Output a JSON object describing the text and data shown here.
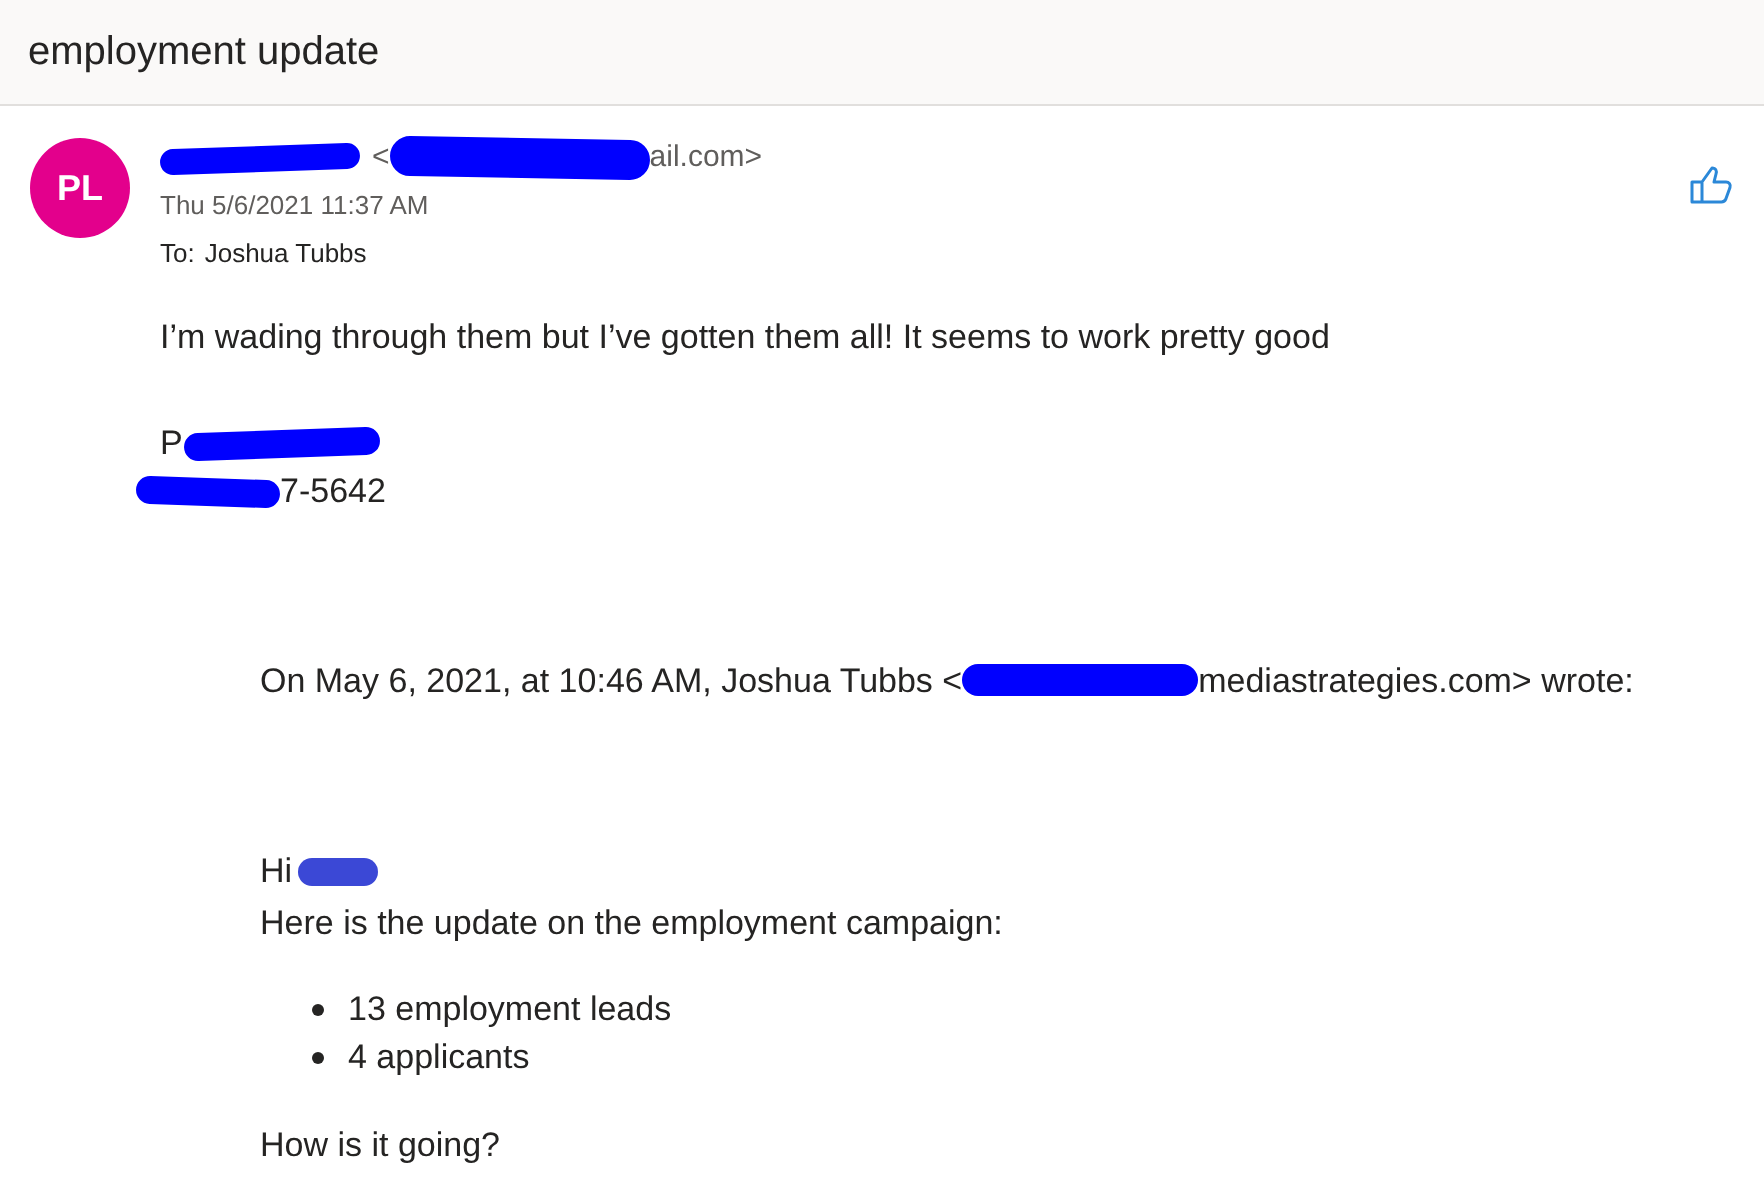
{
  "subject": "employment update",
  "sender": {
    "initials": "PL",
    "address_start": "<",
    "address_end": "ail.com>",
    "date": "Thu 5/6/2021 11:37 AM",
    "to_label": "To:",
    "to": "Joshua Tubbs"
  },
  "body": "I’m wading through them but I’ve gotten them all! It seems to work pretty good",
  "signature": {
    "name_start": "P",
    "phone_end": "7-5642"
  },
  "quoted": {
    "header_before": "On May 6, 2021, at 10:46 AM, Joshua Tubbs <",
    "header_after": "mediastrategies.com> wrote:",
    "greeting": "Hi",
    "intro": "Here is the update on the employment campaign:",
    "bullets": [
      "13 employment leads",
      "4 applicants"
    ],
    "closing": "How is it going?"
  }
}
